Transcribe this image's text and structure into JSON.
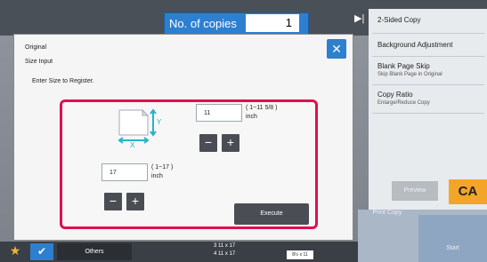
{
  "header": {
    "copies_label": "No. of copies",
    "copies_value": "1"
  },
  "right_panel": {
    "items": [
      {
        "title": "2-Sided Copy",
        "subtitle": ""
      },
      {
        "title": "Background Adjustment",
        "subtitle": ""
      },
      {
        "title": "Blank Page Skip",
        "subtitle": "Skip Blank Page in Original"
      },
      {
        "title": "Copy Ratio",
        "subtitle": "Enlarge/Reduce Copy"
      }
    ],
    "preview_label": "Preview",
    "ca_label": "CA",
    "print_copy_label": "Print Copy",
    "start_label": "Start"
  },
  "bottom_bar": {
    "others_label": "Others",
    "paper_tray_3": "3  11 x 17",
    "paper_tray_4": "4  11 x 17",
    "paper_tag": "8½ x 11"
  },
  "dialog": {
    "title_line1": "Original",
    "title_line2": "Size Input",
    "instruction": "Enter Size to Register.",
    "close_icon": "close-icon",
    "y_field": {
      "value": "11",
      "range": "( 1~11 5/8 )",
      "unit": "inch"
    },
    "x_field": {
      "value": "17",
      "range": "( 1~17 )",
      "unit": "inch"
    },
    "minus_label": "−",
    "plus_label": "+",
    "execute_label": "Execute",
    "axis_y_label": "Y",
    "axis_x_label": "X"
  },
  "colors": {
    "accent": "#2d7fcf",
    "highlight": "#e0104f",
    "ca": "#f3a52a"
  }
}
